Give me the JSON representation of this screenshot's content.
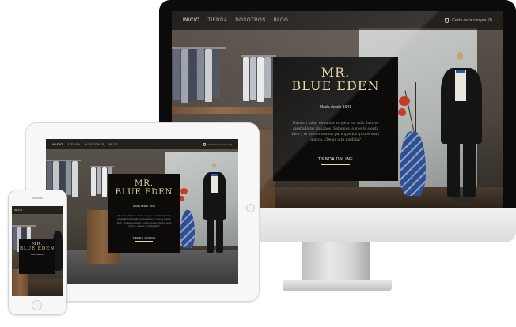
{
  "nav": {
    "items": [
      {
        "label": "INICIO",
        "active": true
      },
      {
        "label": "TIENDA",
        "active": false
      },
      {
        "label": "NOSOTROS",
        "active": false
      },
      {
        "label": "BLOG",
        "active": false
      }
    ],
    "cart_label": "Cesta de la compra (0)",
    "cart_icon": "shopping-cart-icon"
  },
  "hero": {
    "brand_line1": "MR.",
    "brand_line2": "BLUE EDEN",
    "tagline": "Moda desde 1941",
    "description": "Nuestro taller de moda acoge a los más ilustres diseñadores italianos. Sabemos lo que te sienta bien y te asesoraremos para que los gustos sean únicos. ¿Dejas a tu medida?",
    "shop_link": "TIENDA ONLINE"
  },
  "colors": {
    "brand_gold": "#e8d4a4",
    "hero_box": "#0c0b0a",
    "device_white": "#f7f7f7",
    "device_black": "#0b0b0b"
  }
}
